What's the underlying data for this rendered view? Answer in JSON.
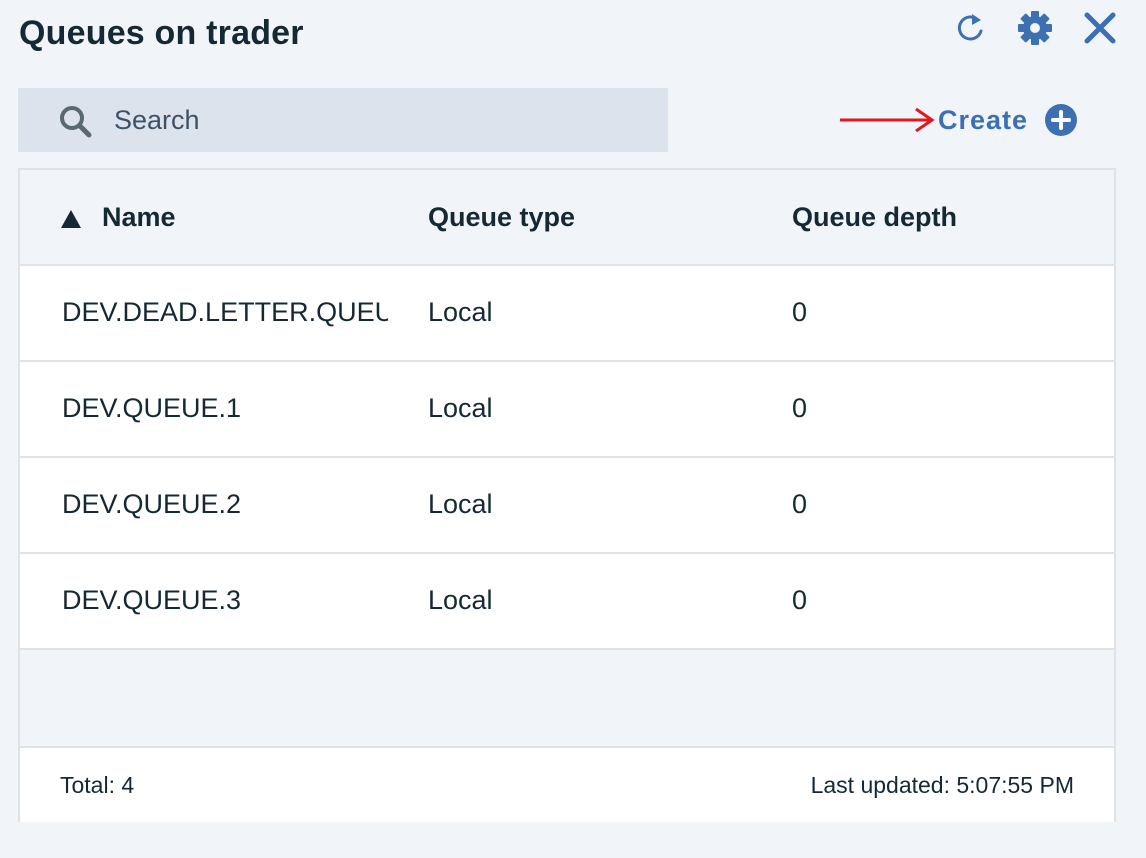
{
  "header": {
    "title": "Queues on trader",
    "icons": [
      "refresh-icon",
      "settings-gear-icon",
      "close-icon"
    ]
  },
  "search": {
    "placeholder": "Search",
    "value": ""
  },
  "toolbar": {
    "create_label": "Create"
  },
  "table": {
    "columns": [
      "Name",
      "Queue type",
      "Queue depth"
    ],
    "sort": {
      "column": "Name",
      "direction": "ascending"
    },
    "rows": [
      {
        "name": "DEV.DEAD.LETTER.QUEUE",
        "type": "Local",
        "depth": "0"
      },
      {
        "name": "DEV.QUEUE.1",
        "type": "Local",
        "depth": "0"
      },
      {
        "name": "DEV.QUEUE.2",
        "type": "Local",
        "depth": "0"
      },
      {
        "name": "DEV.QUEUE.3",
        "type": "Local",
        "depth": "0"
      }
    ]
  },
  "footer": {
    "total": "Total: 4",
    "last_updated": "Last updated: 5:07:55 PM"
  },
  "colors": {
    "accent": "#3d70b2",
    "annotation_arrow": "#e0191f",
    "background": "#f1f4f9",
    "search_background": "#dde3ed"
  }
}
